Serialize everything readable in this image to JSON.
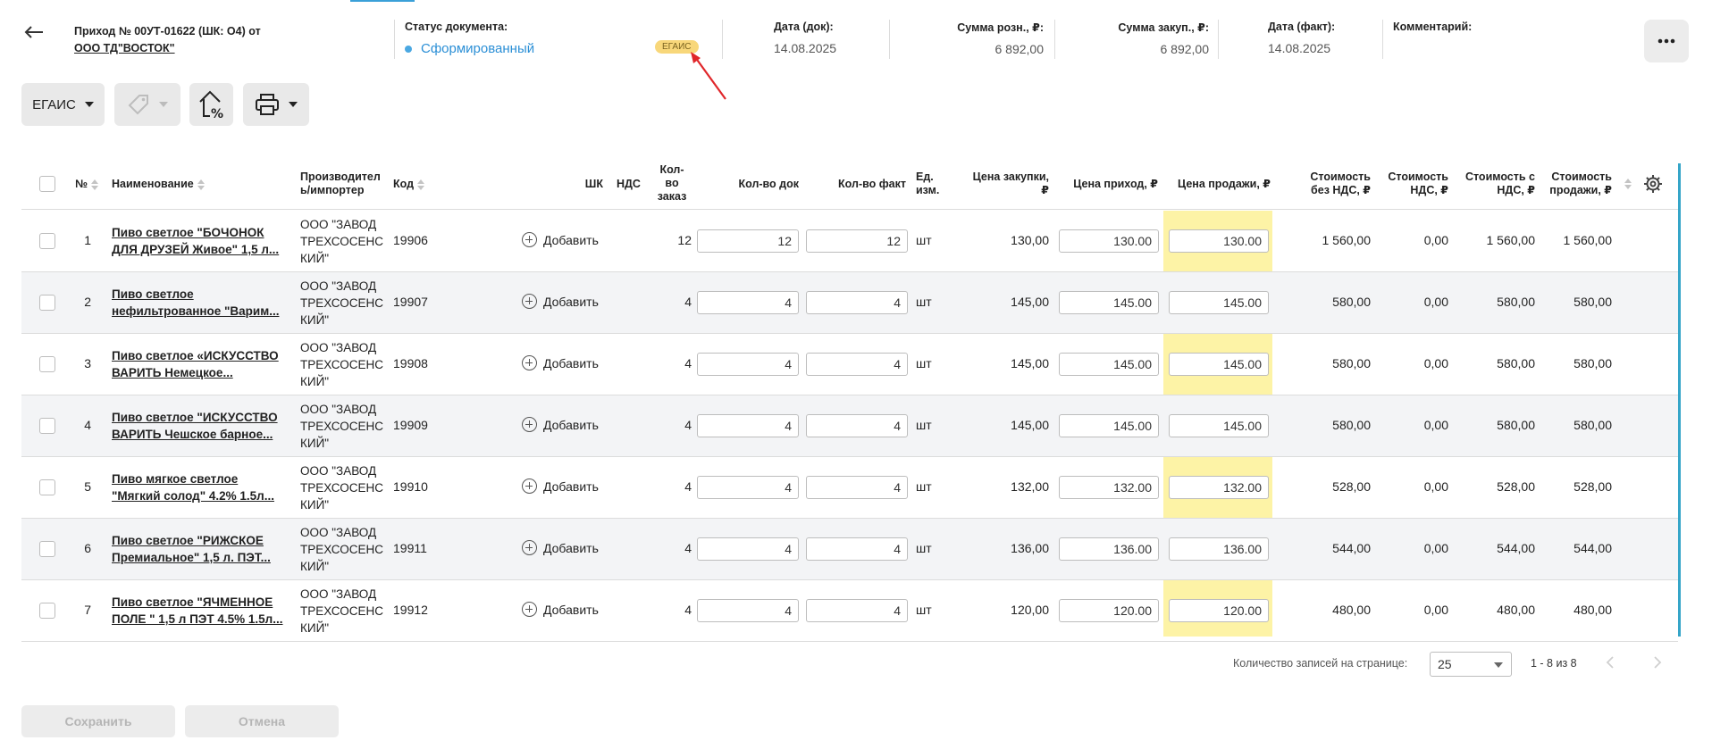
{
  "header": {
    "title_line1": "Приход № 00УТ-01622 (ШК: О4) от",
    "supplier": "ООО ТД\"ВОСТОК\"",
    "status_label": "Статус документа:",
    "status_value": "Сформированный",
    "egais_badge": "ЕГАИС",
    "doc_date_label": "Дата (док):",
    "doc_date_value": "14.08.2025",
    "retail_sum_label": "Сумма розн., ₽:",
    "retail_sum_value": "6 892,00",
    "purchase_sum_label": "Сумма закуп., ₽:",
    "purchase_sum_value": "6 892,00",
    "fact_date_label": "Дата (факт):",
    "fact_date_value": "14.08.2025",
    "comment_label": "Комментарий:",
    "comment_value": ""
  },
  "toolbar": {
    "egais_label": "ЕГАИС"
  },
  "columns": {
    "num": "№",
    "name": "Наименование",
    "manufacturer_1": "Производител",
    "manufacturer_2": "ь/импортер",
    "code": "Код",
    "barcode": "ШК",
    "vat": "НДС",
    "qty_order_1": "Кол-",
    "qty_order_2": "во",
    "qty_order_3": "заказ",
    "qty_doc": "Кол-во док",
    "qty_fact": "Кол-во факт",
    "unit_1": "Ед.",
    "unit_2": "изм.",
    "purchase_price_1": "Цена закупки,",
    "purchase_price_2": "₽",
    "income_price": "Цена приход, ₽",
    "sale_price": "Цена продажи, ₽",
    "cost_no_vat_1": "Стоимость",
    "cost_no_vat_2": "без НДС, ₽",
    "cost_vat_1": "Стоимость",
    "cost_vat_2": "НДС, ₽",
    "cost_with_vat_1": "Стоимость с",
    "cost_with_vat_2": "НДС, ₽",
    "cost_sale_1": "Стоимость",
    "cost_sale_2": "продажи, ₽"
  },
  "rows": [
    {
      "num": "1",
      "name1": "Пиво светлое \"БОЧОНОК",
      "name2": "ДЛЯ ДРУЗЕЙ Живое\" 1,5 л...",
      "mfr1": "ООО \"ЗАВОД",
      "mfr2": "ТРЕХСОСЕНС",
      "mfr3": "КИЙ\"",
      "code": "19906",
      "add": "Добавить",
      "qty_order": "12",
      "qty_doc": "12",
      "qty_fact": "12",
      "unit": "шт",
      "purchase_price": "130,00",
      "income_price": "130.00",
      "sale_price": "130.00",
      "cost_no_vat": "1 560,00",
      "cost_vat": "0,00",
      "cost_with_vat": "1 560,00",
      "cost_sale": "1 560,00"
    },
    {
      "num": "2",
      "name1": "Пиво светлое",
      "name2": "нефильтрованное \"Варим...",
      "mfr1": "ООО \"ЗАВОД",
      "mfr2": "ТРЕХСОСЕНС",
      "mfr3": "КИЙ\"",
      "code": "19907",
      "add": "Добавить",
      "qty_order": "4",
      "qty_doc": "4",
      "qty_fact": "4",
      "unit": "шт",
      "purchase_price": "145,00",
      "income_price": "145.00",
      "sale_price": "145.00",
      "cost_no_vat": "580,00",
      "cost_vat": "0,00",
      "cost_with_vat": "580,00",
      "cost_sale": "580,00"
    },
    {
      "num": "3",
      "name1": "Пиво светлое «ИСКУССТВО",
      "name2": "ВАРИТЬ Немецкое...",
      "mfr1": "ООО \"ЗАВОД",
      "mfr2": "ТРЕХСОСЕНС",
      "mfr3": "КИЙ\"",
      "code": "19908",
      "add": "Добавить",
      "qty_order": "4",
      "qty_doc": "4",
      "qty_fact": "4",
      "unit": "шт",
      "purchase_price": "145,00",
      "income_price": "145.00",
      "sale_price": "145.00",
      "cost_no_vat": "580,00",
      "cost_vat": "0,00",
      "cost_with_vat": "580,00",
      "cost_sale": "580,00"
    },
    {
      "num": "4",
      "name1": "Пиво светлое \"ИСКУССТВО",
      "name2": "ВАРИТЬ Чешское барное...",
      "mfr1": "ООО \"ЗАВОД",
      "mfr2": "ТРЕХСОСЕНС",
      "mfr3": "КИЙ\"",
      "code": "19909",
      "add": "Добавить",
      "qty_order": "4",
      "qty_doc": "4",
      "qty_fact": "4",
      "unit": "шт",
      "purchase_price": "145,00",
      "income_price": "145.00",
      "sale_price": "145.00",
      "cost_no_vat": "580,00",
      "cost_vat": "0,00",
      "cost_with_vat": "580,00",
      "cost_sale": "580,00"
    },
    {
      "num": "5",
      "name1": "Пиво мягкое светлое",
      "name2": "\"Мягкий солод\" 4.2% 1.5л...",
      "mfr1": "ООО \"ЗАВОД",
      "mfr2": "ТРЕХСОСЕНС",
      "mfr3": "КИЙ\"",
      "code": "19910",
      "add": "Добавить",
      "qty_order": "4",
      "qty_doc": "4",
      "qty_fact": "4",
      "unit": "шт",
      "purchase_price": "132,00",
      "income_price": "132.00",
      "sale_price": "132.00",
      "cost_no_vat": "528,00",
      "cost_vat": "0,00",
      "cost_with_vat": "528,00",
      "cost_sale": "528,00"
    },
    {
      "num": "6",
      "name1": "Пиво светлое \"РИЖСКОЕ",
      "name2": "Премиальное\" 1,5 л. ПЭТ...",
      "mfr1": "ООО \"ЗАВОД",
      "mfr2": "ТРЕХСОСЕНС",
      "mfr3": "КИЙ\"",
      "code": "19911",
      "add": "Добавить",
      "qty_order": "4",
      "qty_doc": "4",
      "qty_fact": "4",
      "unit": "шт",
      "purchase_price": "136,00",
      "income_price": "136.00",
      "sale_price": "136.00",
      "cost_no_vat": "544,00",
      "cost_vat": "0,00",
      "cost_with_vat": "544,00",
      "cost_sale": "544,00"
    },
    {
      "num": "7",
      "name1": "Пиво светлое \"ЯЧМЕННОЕ",
      "name2": "ПОЛЕ \" 1,5 л ПЭТ 4.5% 1.5л...",
      "mfr1": "ООО \"ЗАВОД",
      "mfr2": "ТРЕХСОСЕНС",
      "mfr3": "КИЙ\"",
      "code": "19912",
      "add": "Добавить",
      "qty_order": "4",
      "qty_doc": "4",
      "qty_fact": "4",
      "unit": "шт",
      "purchase_price": "120,00",
      "income_price": "120.00",
      "sale_price": "120.00",
      "cost_no_vat": "480,00",
      "cost_vat": "0,00",
      "cost_with_vat": "480,00",
      "cost_sale": "480,00"
    }
  ],
  "pagination": {
    "per_page_label": "Количество записей на странице:",
    "per_page_value": "25",
    "range": "1 - 8 из 8"
  },
  "footer": {
    "save": "Сохранить",
    "cancel": "Отмена"
  },
  "colors": {
    "status": "#2b8fd6",
    "badge": "#f8d77a",
    "highlight_column": "#fdf3a6",
    "accent": "#35a5c8",
    "arrow": "#e0262a"
  },
  "icons": {
    "back": "arrow-left-icon",
    "more": "more-dots-icon",
    "tag": "price-tag-icon",
    "markup": "house-percent-icon",
    "print": "printer-icon",
    "settings": "gear-icon"
  }
}
